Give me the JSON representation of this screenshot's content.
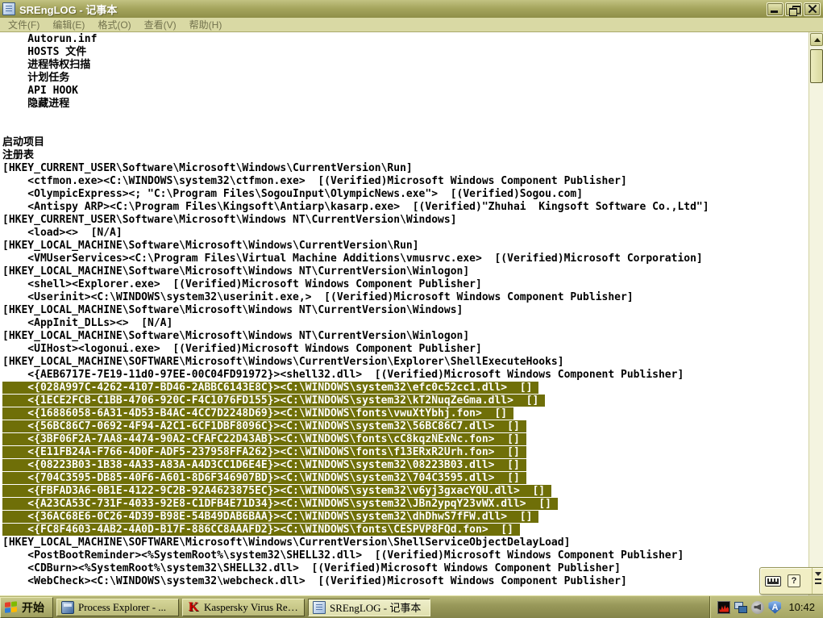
{
  "window": {
    "title": "SREngLOG - 记事本",
    "menus": [
      "文件(F)",
      "编辑(E)",
      "格式(O)",
      "查看(V)",
      "帮助(H)"
    ]
  },
  "editor": {
    "lines": [
      {
        "t": "    Autorun.inf",
        "sel": false
      },
      {
        "t": "    HOSTS 文件",
        "sel": false
      },
      {
        "t": "    进程特权扫描",
        "sel": false
      },
      {
        "t": "    计划任务",
        "sel": false
      },
      {
        "t": "    API HOOK",
        "sel": false
      },
      {
        "t": "    隐藏进程",
        "sel": false
      },
      {
        "t": "",
        "sel": false
      },
      {
        "t": "",
        "sel": false
      },
      {
        "t": "启动项目",
        "sel": false
      },
      {
        "t": "注册表",
        "sel": false
      },
      {
        "t": "[HKEY_CURRENT_USER\\Software\\Microsoft\\Windows\\CurrentVersion\\Run]",
        "sel": false
      },
      {
        "t": "    <ctfmon.exe><C:\\WINDOWS\\system32\\ctfmon.exe>  [(Verified)Microsoft Windows Component Publisher]",
        "sel": false
      },
      {
        "t": "    <OlympicExpress><; \"C:\\Program Files\\SogouInput\\OlympicNews.exe\">  [(Verified)Sogou.com]",
        "sel": false
      },
      {
        "t": "    <Antispy ARP><C:\\Program Files\\Kingsoft\\Antiarp\\kasarp.exe>  [(Verified)\"Zhuhai  Kingsoft Software Co.,Ltd\"]",
        "sel": false
      },
      {
        "t": "[HKEY_CURRENT_USER\\Software\\Microsoft\\Windows NT\\CurrentVersion\\Windows]",
        "sel": false
      },
      {
        "t": "    <load><>  [N/A]",
        "sel": false
      },
      {
        "t": "[HKEY_LOCAL_MACHINE\\Software\\Microsoft\\Windows\\CurrentVersion\\Run]",
        "sel": false
      },
      {
        "t": "    <VMUserServices><C:\\Program Files\\Virtual Machine Additions\\vmusrvc.exe>  [(Verified)Microsoft Corporation]",
        "sel": false
      },
      {
        "t": "[HKEY_LOCAL_MACHINE\\Software\\Microsoft\\Windows NT\\CurrentVersion\\Winlogon]",
        "sel": false
      },
      {
        "t": "    <shell><Explorer.exe>  [(Verified)Microsoft Windows Component Publisher]",
        "sel": false
      },
      {
        "t": "    <Userinit><C:\\WINDOWS\\system32\\userinit.exe,>  [(Verified)Microsoft Windows Component Publisher]",
        "sel": false
      },
      {
        "t": "[HKEY_LOCAL_MACHINE\\Software\\Microsoft\\Windows NT\\CurrentVersion\\Windows]",
        "sel": false
      },
      {
        "t": "    <AppInit_DLLs><>  [N/A]",
        "sel": false
      },
      {
        "t": "[HKEY_LOCAL_MACHINE\\Software\\Microsoft\\Windows NT\\CurrentVersion\\Winlogon]",
        "sel": false
      },
      {
        "t": "    <UIHost><logonui.exe>  [(Verified)Microsoft Windows Component Publisher]",
        "sel": false
      },
      {
        "t": "[HKEY_LOCAL_MACHINE\\SOFTWARE\\Microsoft\\Windows\\CurrentVersion\\Explorer\\ShellExecuteHooks]",
        "sel": false
      },
      {
        "t": "    <{AEB6717E-7E19-11d0-97EE-00C04FD91972}><shell32.dll>  [(Verified)Microsoft Windows Component Publisher]",
        "sel": false
      },
      {
        "t": "    <{028A997C-4262-4107-BD46-2ABBC6143E8C}><C:\\WINDOWS\\system32\\efc0c52cc1.dll>  []",
        "sel": true
      },
      {
        "t": "    <{1ECE2FCB-C1BB-4706-920C-F4C1076FD155}><C:\\WINDOWS\\system32\\kT2NuqZeGma.dll>  []",
        "sel": true
      },
      {
        "t": "    <{16886058-6A31-4D53-B4AC-4CC7D2248D69}><C:\\WINDOWS\\fonts\\vwuXtYbhj.fon>  []",
        "sel": true
      },
      {
        "t": "    <{56BC86C7-0692-4F94-A2C1-6CF1DBF8096C}><C:\\WINDOWS\\system32\\56BC86C7.dll>  []",
        "sel": true
      },
      {
        "t": "    <{3BF06F2A-7AA8-4474-90A2-CFAFC22D43AB}><C:\\WINDOWS\\fonts\\cC8kqzNExNc.fon>  []",
        "sel": true
      },
      {
        "t": "    <{E11FB24A-F766-4D0F-ADF5-237958FFA262}><C:\\WINDOWS\\fonts\\f13ERxR2Urh.fon>  []",
        "sel": true
      },
      {
        "t": "    <{08223B03-1B38-4A33-A83A-A4D3CC1D6E4E}><C:\\WINDOWS\\system32\\08223B03.dll>  []",
        "sel": true
      },
      {
        "t": "    <{704C3595-DB85-40F6-A601-8D6F346907BD}><C:\\WINDOWS\\system32\\704C3595.dll>  []",
        "sel": true
      },
      {
        "t": "    <{FBFAD3A6-0B1E-4122-9C2B-92A4623875EC}><C:\\WINDOWS\\system32\\v6yj3gxacYQU.dll>  []",
        "sel": true
      },
      {
        "t": "    <{A23CA53C-731F-4033-92E8-C1DFB4E71D34}><C:\\WINDOWS\\system32\\JBn2ypqY23vWX.dll>  []",
        "sel": true
      },
      {
        "t": "    <{36AC68E6-0C26-4D39-B98E-54B49DAB6BAA}><C:\\WINDOWS\\system32\\dhDhwS7fFW.dll>  []",
        "sel": true
      },
      {
        "t": "    <{FC8F4603-4AB2-4A0D-B17F-886CC8AAAFD2}><C:\\WINDOWS\\fonts\\CESPVP8FQd.fon>  []",
        "sel": true
      },
      {
        "t": "[HKEY_LOCAL_MACHINE\\SOFTWARE\\Microsoft\\Windows\\CurrentVersion\\ShellServiceObjectDelayLoad]",
        "sel": false
      },
      {
        "t": "    <PostBootReminder><%SystemRoot%\\system32\\SHELL32.dll>  [(Verified)Microsoft Windows Component Publisher]",
        "sel": false
      },
      {
        "t": "    <CDBurn><%SystemRoot%\\system32\\SHELL32.dll>  [(Verified)Microsoft Windows Component Publisher]",
        "sel": false
      },
      {
        "t": "    <WebCheck><C:\\WINDOWS\\system32\\webcheck.dll>  [(Verified)Microsoft Windows Component Publisher]",
        "sel": false
      }
    ]
  },
  "language_bar": {
    "help_glyph": "?",
    "icons": [
      "keyboard-icon",
      "help-icon",
      "options-chevron-icon"
    ]
  },
  "taskbar": {
    "start_label": "开始",
    "tasks": [
      {
        "id": "process-explorer",
        "icon": "process-explorer-icon",
        "label": "Process Explorer - ...",
        "glyph": "",
        "active": false
      },
      {
        "id": "kaspersky",
        "icon": "kaspersky-icon",
        "label": "Kaspersky Virus Rem...",
        "glyph": "K",
        "active": false
      },
      {
        "id": "notepad",
        "icon": "notepad-icon",
        "label": "SREngLOG - 记事本",
        "glyph": "",
        "active": true
      }
    ],
    "tray": {
      "icons": [
        "cpu-activity-icon",
        "network-icon",
        "volume-icon",
        "antivirus-shield-icon"
      ],
      "shield_glyph": "A",
      "clock": "10:42"
    }
  },
  "colors": {
    "selection": "#6F6F08",
    "titlebar": "#A6A65E",
    "menubar": "#D9D9A4",
    "taskbar": "#8F8F4E",
    "editor_background": "#FFFFFF",
    "editor_text": "#000000"
  }
}
